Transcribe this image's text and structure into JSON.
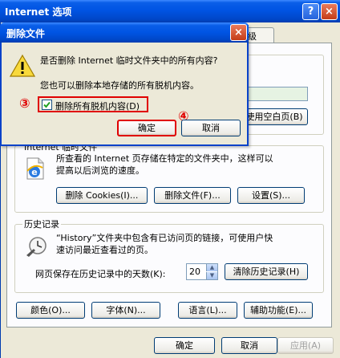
{
  "main_window": {
    "title": "Internet 选项",
    "help_button": "?",
    "close_button": "×",
    "tabs": {
      "advanced_fragment": "级"
    },
    "home_group": {
      "use_blank_button": "使用空白页(B)"
    },
    "temp_files_group": {
      "legend": "Internet 临时文件",
      "desc_line1": "所查看的 Internet 页存储在特定的文件夹中，这样可以",
      "desc_line2": "提高以后浏览的速度。",
      "delete_cookies_button": "删除 Cookies(I)...",
      "delete_files_button": "删除文件(F)...",
      "settings_button": "设置(S)..."
    },
    "history_group": {
      "legend": "历史记录",
      "desc_line1": "“History”文件夹中包含有已访问页的链接，可使用户快",
      "desc_line2": "速访问最近查看过的页。",
      "days_label": "网页保存在历史记录中的天数(K):",
      "days_value": "20",
      "clear_history_button": "清除历史记录(H)"
    },
    "bottom_row": {
      "colors_button": "颜色(O)...",
      "fonts_button": "字体(N)...",
      "languages_button": "语言(L)...",
      "accessibility_button": "辅助功能(E)..."
    },
    "footer": {
      "ok_button": "确定",
      "cancel_button": "取消",
      "apply_button": "应用(A)"
    }
  },
  "dialog": {
    "title": "删除文件",
    "close_button": "×",
    "question": "是否删除 Internet 临时文件夹中的所有内容?",
    "offline_note": "您也可以删除本地存储的所有脱机内容。",
    "offline_checkbox_label": "删除所有脱机内容(D)",
    "offline_checkbox_checked": true,
    "ok_button": "确定",
    "cancel_button": "取消",
    "step3_marker": "③",
    "step4_marker": "④"
  },
  "colors": {
    "highlight": "#e00000",
    "titlebar": "#0054e3"
  },
  "icons": [
    "warning-icon",
    "ie-page-icon",
    "history-icon",
    "help-icon",
    "close-icon",
    "check-icon",
    "spin-up-icon",
    "spin-down-icon"
  ]
}
